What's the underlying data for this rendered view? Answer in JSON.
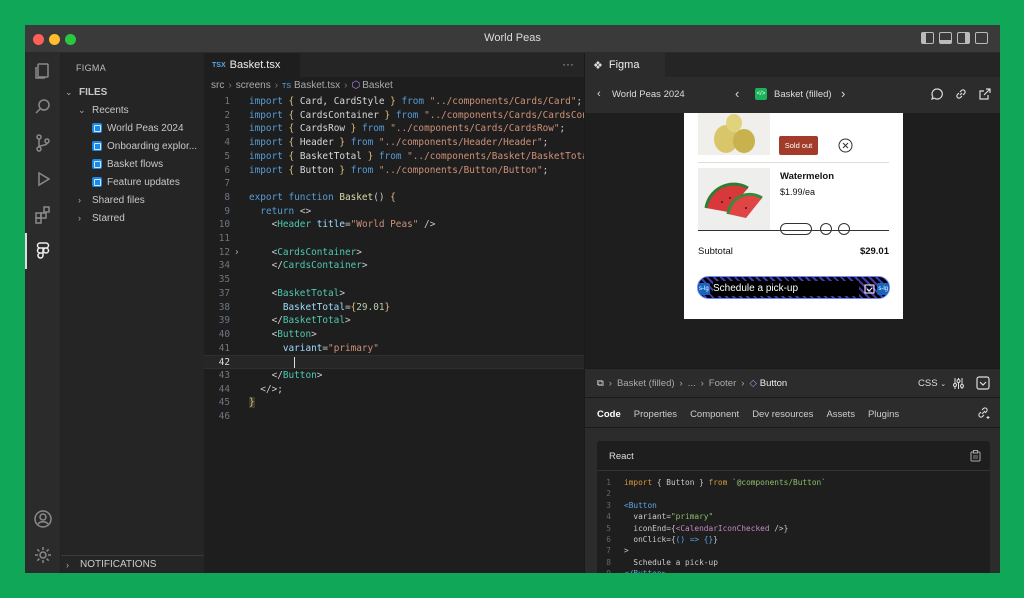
{
  "window": {
    "title": "World Peas"
  },
  "sidebar": {
    "section_title": "FIGMA",
    "files_header": "FILES",
    "recents_label": "Recents",
    "recent_files": [
      "World Peas 2024",
      "Onboarding explor...",
      "Basket flows",
      "Feature updates"
    ],
    "shared_label": "Shared files",
    "starred_label": "Starred",
    "notifications_label": "NOTIFICATIONS"
  },
  "editor": {
    "tab_label": "Basket.tsx",
    "tab_lang": "TSX",
    "more_label": "···",
    "breadcrumb": [
      "src",
      "screens",
      "Basket.tsx",
      "Basket"
    ],
    "breadcrumb_lang": "TS"
  },
  "figma": {
    "tab_label": "Figma",
    "file_name": "World Peas 2024",
    "frame_name": "Basket (filled)",
    "product1_badge": "Sold out",
    "product2_name": "Watermelon",
    "product2_price": "$1.99/ea",
    "subtotal_label": "Subtotal",
    "subtotal_value": "$29.01",
    "button_label": "Schedule a pick-up",
    "spacing_tag": "s-lg",
    "layer_path": [
      "Basket (filled)",
      "...",
      "Footer",
      "Button"
    ],
    "css_label": "CSS",
    "inspector_tabs": [
      "Code",
      "Properties",
      "Component",
      "Dev resources",
      "Assets",
      "Plugins"
    ],
    "code_lang": "React"
  },
  "colors": {
    "accent_green": "#10a858",
    "sold_out": "#a23b2a",
    "figma_blue": "#1565c0"
  }
}
